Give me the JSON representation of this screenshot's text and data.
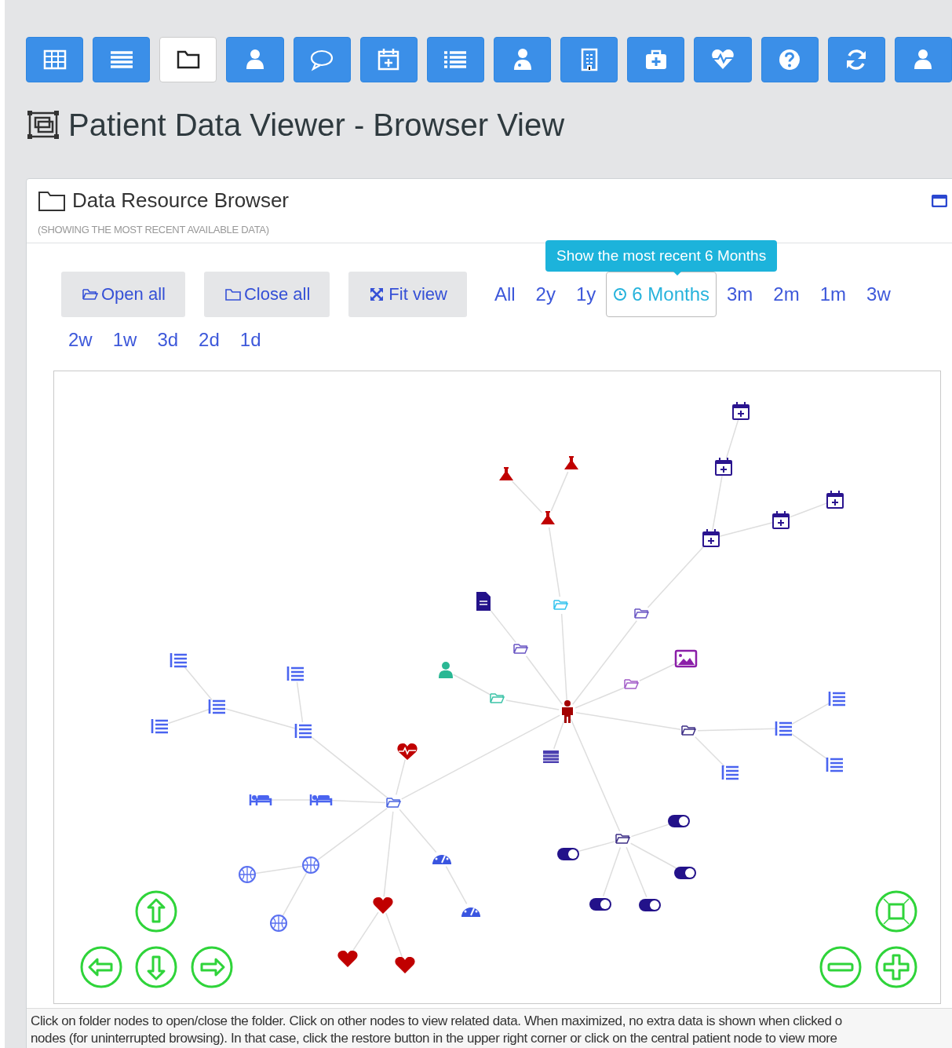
{
  "toolbar": [
    {
      "selected": false
    },
    {
      "selected": false
    },
    {
      "selected": true
    },
    {
      "selected": false
    },
    {
      "selected": false
    },
    {
      "selected": false
    },
    {
      "selected": false
    },
    {
      "selected": false
    },
    {
      "selected": false
    },
    {
      "selected": false
    },
    {
      "selected": false
    },
    {
      "selected": false
    },
    {
      "selected": false
    },
    {
      "selected": false
    }
  ],
  "page_title": "Patient Data Viewer - Browser View",
  "panel": {
    "title": "Data Resource Browser",
    "subtitle": "(SHOWING THE MOST RECENT AVAILABLE DATA)",
    "buttons": [
      {
        "kind": "open",
        "label": "Open all"
      },
      {
        "kind": "close",
        "label": "Close all"
      },
      {
        "kind": "fit",
        "label": "Fit view"
      }
    ],
    "tooltip": "Show the most recent 6 Months",
    "ranges": [
      {
        "label": "All",
        "selected": false
      },
      {
        "label": "2y",
        "selected": false
      },
      {
        "label": "1y",
        "selected": false
      },
      {
        "label": "6 Months",
        "selected": true
      },
      {
        "label": "3m",
        "selected": false
      },
      {
        "label": "2m",
        "selected": false
      },
      {
        "label": "1m",
        "selected": false
      },
      {
        "label": "3w",
        "selected": false
      },
      {
        "label": "2w",
        "selected": false
      },
      {
        "label": "1w",
        "selected": false
      },
      {
        "label": "3d",
        "selected": false
      },
      {
        "label": "2d",
        "selected": false
      },
      {
        "label": "1d",
        "selected": false
      }
    ],
    "footer": [
      "Click on folder nodes to open/close the folder. Click on other nodes to view related data. When maximized, no extra data is shown when clicked o",
      "nodes (for uninterrupted browsing). In that case, click the restore button in the upper right corner or click on the central patient node to view more"
    ]
  }
}
